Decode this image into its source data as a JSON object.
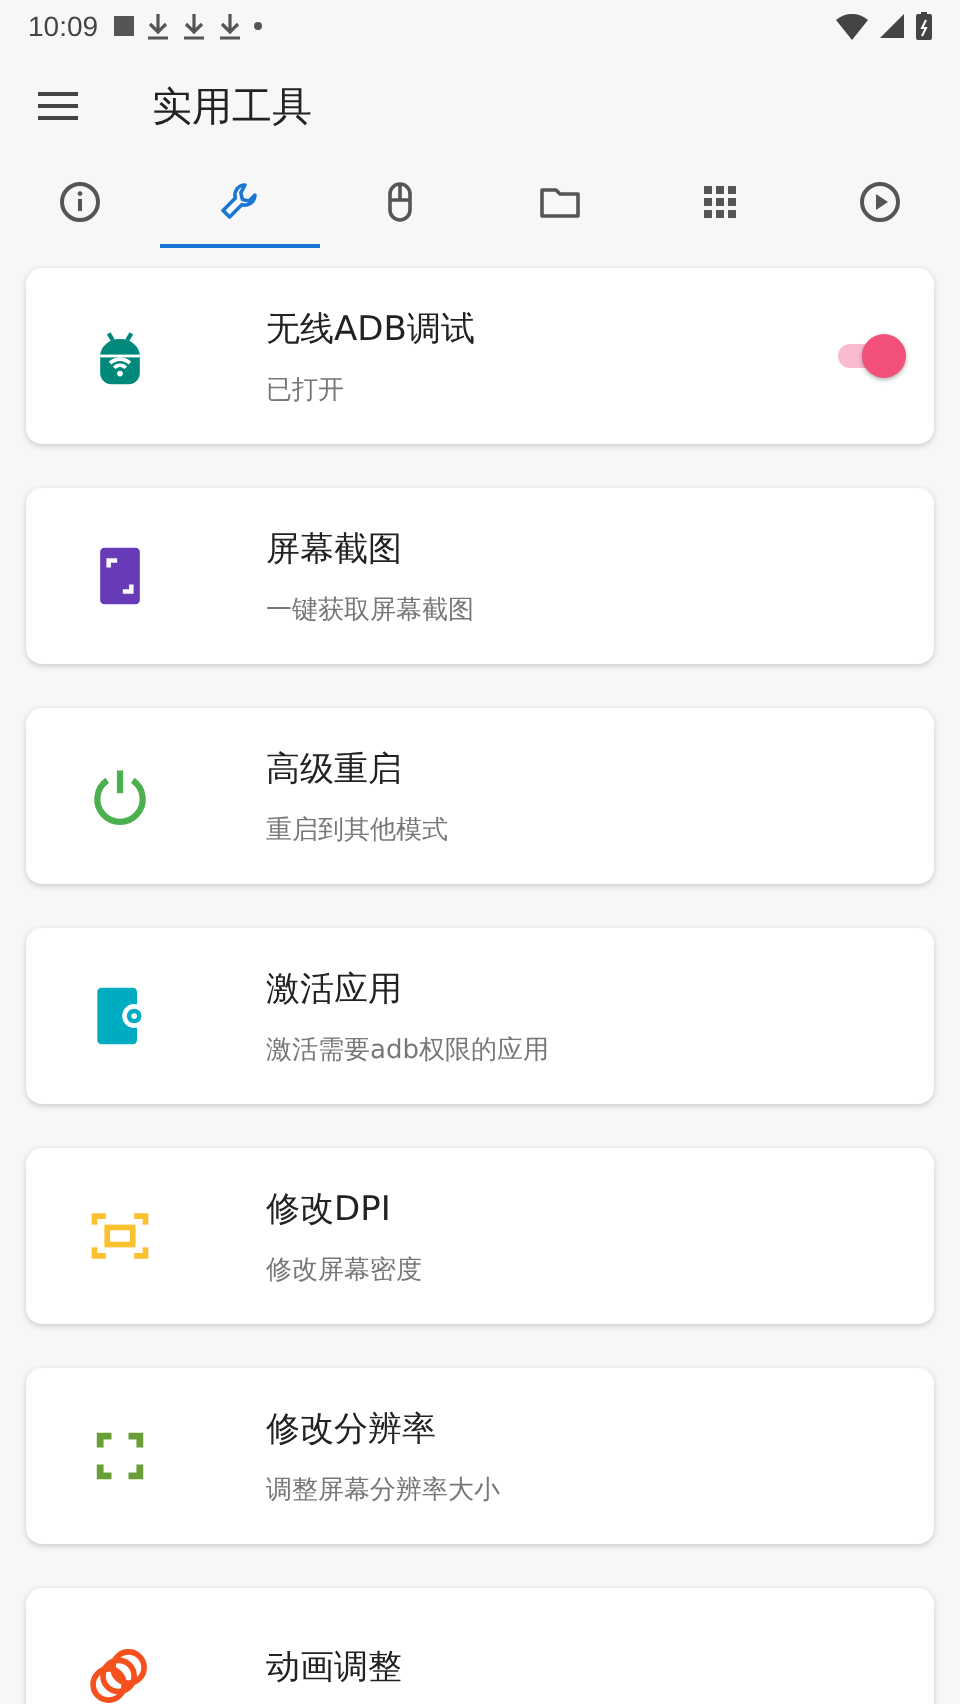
{
  "status_bar": {
    "time": "10:09"
  },
  "toolbar": {
    "title": "实用工具"
  },
  "tabs": [
    {
      "selected": false
    },
    {
      "selected": true
    },
    {
      "selected": false
    },
    {
      "selected": false
    },
    {
      "selected": false
    },
    {
      "selected": false
    }
  ],
  "tools": [
    {
      "kind": "toggle",
      "title": "无线ADB调试",
      "subtitle": "已打开",
      "on": true
    },
    {
      "kind": "action",
      "title": "屏幕截图",
      "subtitle": "一键获取屏幕截图"
    },
    {
      "kind": "action",
      "title": "高级重启",
      "subtitle": "重启到其他模式"
    },
    {
      "kind": "action",
      "title": "激活应用",
      "subtitle": "激活需要adb权限的应用"
    },
    {
      "kind": "action",
      "title": "修改DPI",
      "subtitle": "修改屏幕密度"
    },
    {
      "kind": "action",
      "title": "修改分辨率",
      "subtitle": "调整屏幕分辨率大小"
    },
    {
      "kind": "action",
      "title": "动画调整"
    }
  ]
}
